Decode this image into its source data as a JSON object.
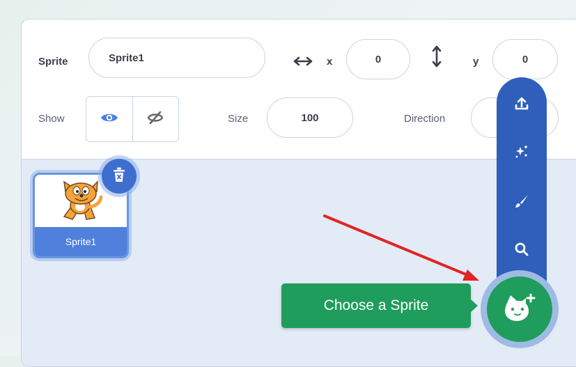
{
  "sprite_info": {
    "sprite_label": "Sprite",
    "sprite_name": "Sprite1",
    "x_label": "x",
    "x_value": "0",
    "y_label": "y",
    "y_value": "0",
    "show_label": "Show",
    "size_label": "Size",
    "size_value": "100",
    "direction_label": "Direction"
  },
  "sprite_list": [
    {
      "name": "Sprite1",
      "selected": true
    }
  ],
  "sprite_menu": {
    "items": [
      "upload-sprite",
      "surprise",
      "paint",
      "search"
    ]
  },
  "choose_sprite": {
    "tooltip": "Choose a Sprite"
  },
  "colors": {
    "menu_blue": "#2f5fbb",
    "selected_blue": "#4f80db",
    "choose_green": "#1f9d5c",
    "arrow_red": "#e02424"
  }
}
